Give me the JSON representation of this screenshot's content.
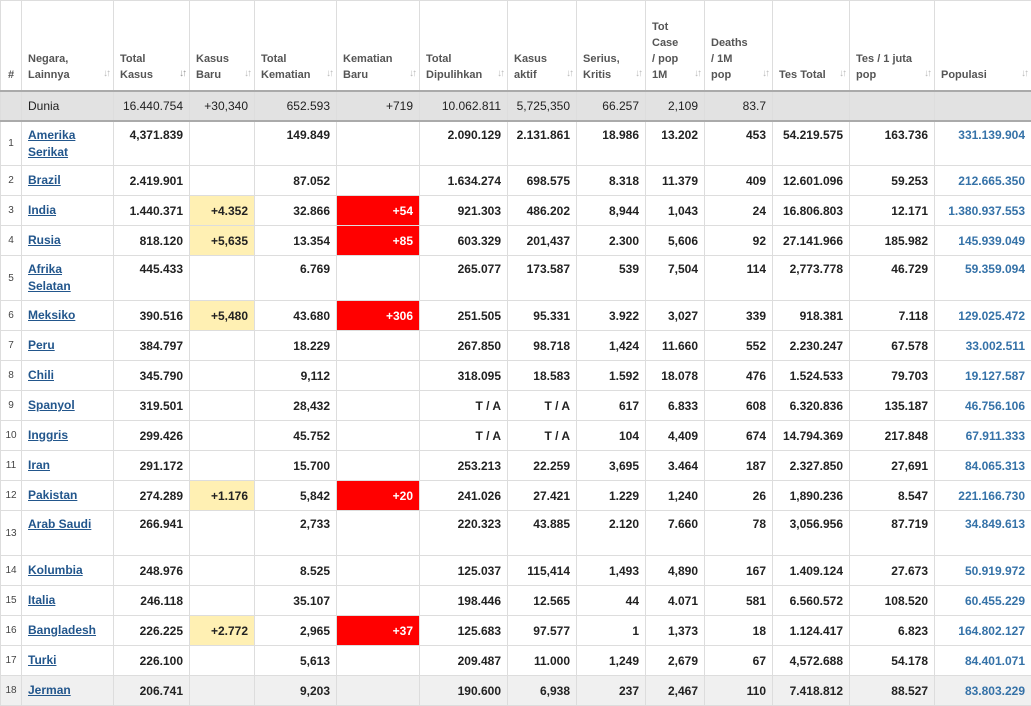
{
  "headers": [
    {
      "label": "#",
      "sort": false
    },
    {
      "label": "Negara, Lainnya",
      "sort": true
    },
    {
      "label": "Total Kasus",
      "sort": true,
      "active": true
    },
    {
      "label": "Kasus Baru",
      "sort": true
    },
    {
      "label": "Total Kematian",
      "sort": true
    },
    {
      "label": "Kematian Baru",
      "sort": true
    },
    {
      "label": "Total Dipulihkan",
      "sort": true
    },
    {
      "label": "Kasus aktif",
      "sort": true
    },
    {
      "label": "Serius, Kritis",
      "sort": true
    },
    {
      "label": "Tot Case / pop 1M",
      "sort": true
    },
    {
      "label": "Deaths / 1M pop",
      "sort": true
    },
    {
      "label": "Tes Total",
      "sort": true
    },
    {
      "label": "Tes / 1 juta pop",
      "sort": true
    },
    {
      "label": "Populasi",
      "sort": true
    }
  ],
  "sort_icon": "sort-arrows-icon",
  "world": {
    "num": "",
    "country": "Dunia",
    "total_cases": "16.440.754",
    "new_cases": "+30,340",
    "total_deaths": "652.593",
    "new_deaths": "+719",
    "recovered": "10.062.811",
    "active": "5,725,350",
    "critical": "66.257",
    "cases_per_1m": "2,109",
    "deaths_per_1m": "83.7",
    "tests": "",
    "tests_per_1m": "",
    "population": ""
  },
  "rows": [
    {
      "num": "1",
      "country": "Amerika Serikat",
      "total_cases": "4,371.839",
      "new_cases": "",
      "total_deaths": "149.849",
      "new_deaths": "",
      "recovered": "2.090.129",
      "active": "2.131.861",
      "critical": "18.986",
      "cases_per_1m": "13.202",
      "deaths_per_1m": "453",
      "tests": "54.219.575",
      "tests_per_1m": "163.736",
      "population": "331.139.904"
    },
    {
      "num": "2",
      "country": "Brazil",
      "total_cases": "2.419.901",
      "new_cases": "",
      "total_deaths": "87.052",
      "new_deaths": "",
      "recovered": "1.634.274",
      "active": "698.575",
      "critical": "8.318",
      "cases_per_1m": "11.379",
      "deaths_per_1m": "409",
      "tests": "12.601.096",
      "tests_per_1m": "59.253",
      "population": "212.665.350"
    },
    {
      "num": "3",
      "country": "India",
      "total_cases": "1.440.371",
      "new_cases": "+4.352",
      "total_deaths": "32.866",
      "new_deaths": "+54",
      "recovered": "921.303",
      "active": "486.202",
      "critical": "8,944",
      "cases_per_1m": "1,043",
      "deaths_per_1m": "24",
      "tests": "16.806.803",
      "tests_per_1m": "12.171",
      "population": "1.380.937.553"
    },
    {
      "num": "4",
      "country": "Rusia",
      "total_cases": "818.120",
      "new_cases": "+5,635",
      "total_deaths": "13.354",
      "new_deaths": "+85",
      "recovered": "603.329",
      "active": "201,437",
      "critical": "2.300",
      "cases_per_1m": "5,606",
      "deaths_per_1m": "92",
      "tests": "27.141.966",
      "tests_per_1m": "185.982",
      "population": "145.939.049"
    },
    {
      "num": "5",
      "country": "Afrika Selatan",
      "total_cases": "445.433",
      "new_cases": "",
      "total_deaths": "6.769",
      "new_deaths": "",
      "recovered": "265.077",
      "active": "173.587",
      "critical": "539",
      "cases_per_1m": "7,504",
      "deaths_per_1m": "114",
      "tests": "2,773.778",
      "tests_per_1m": "46.729",
      "population": "59.359.094"
    },
    {
      "num": "6",
      "country": "Meksiko",
      "total_cases": "390.516",
      "new_cases": "+5,480",
      "total_deaths": "43.680",
      "new_deaths": "+306",
      "recovered": "251.505",
      "active": "95.331",
      "critical": "3.922",
      "cases_per_1m": "3,027",
      "deaths_per_1m": "339",
      "tests": "918.381",
      "tests_per_1m": "7.118",
      "population": "129.025.472"
    },
    {
      "num": "7",
      "country": "Peru",
      "total_cases": "384.797",
      "new_cases": "",
      "total_deaths": "18.229",
      "new_deaths": "",
      "recovered": "267.850",
      "active": "98.718",
      "critical": "1,424",
      "cases_per_1m": "11.660",
      "deaths_per_1m": "552",
      "tests": "2.230.247",
      "tests_per_1m": "67.578",
      "population": "33.002.511"
    },
    {
      "num": "8",
      "country": "Chili",
      "total_cases": "345.790",
      "new_cases": "",
      "total_deaths": "9,112",
      "new_deaths": "",
      "recovered": "318.095",
      "active": "18.583",
      "critical": "1.592",
      "cases_per_1m": "18.078",
      "deaths_per_1m": "476",
      "tests": "1.524.533",
      "tests_per_1m": "79.703",
      "population": "19.127.587"
    },
    {
      "num": "9",
      "country": "Spanyol",
      "total_cases": "319.501",
      "new_cases": "",
      "total_deaths": "28,432",
      "new_deaths": "",
      "recovered": "T / A",
      "active": "T / A",
      "critical": "617",
      "cases_per_1m": "6.833",
      "deaths_per_1m": "608",
      "tests": "6.320.836",
      "tests_per_1m": "135.187",
      "population": "46.756.106"
    },
    {
      "num": "10",
      "country": "Inggris",
      "total_cases": "299.426",
      "new_cases": "",
      "total_deaths": "45.752",
      "new_deaths": "",
      "recovered": "T / A",
      "active": "T / A",
      "critical": "104",
      "cases_per_1m": "4,409",
      "deaths_per_1m": "674",
      "tests": "14.794.369",
      "tests_per_1m": "217.848",
      "population": "67.911.333"
    },
    {
      "num": "11",
      "country": "Iran",
      "total_cases": "291.172",
      "new_cases": "",
      "total_deaths": "15.700",
      "new_deaths": "",
      "recovered": "253.213",
      "active": "22.259",
      "critical": "3,695",
      "cases_per_1m": "3.464",
      "deaths_per_1m": "187",
      "tests": "2.327.850",
      "tests_per_1m": "27,691",
      "population": "84.065.313"
    },
    {
      "num": "12",
      "country": "Pakistan",
      "total_cases": "274.289",
      "new_cases": "+1.176",
      "total_deaths": "5,842",
      "new_deaths": "+20",
      "recovered": "241.026",
      "active": "27.421",
      "critical": "1.229",
      "cases_per_1m": "1,240",
      "deaths_per_1m": "26",
      "tests": "1,890.236",
      "tests_per_1m": "8.547",
      "population": "221.166.730"
    },
    {
      "num": "13",
      "country": "Arab Saudi",
      "total_cases": "266.941",
      "new_cases": "",
      "total_deaths": "2,733",
      "new_deaths": "",
      "recovered": "220.323",
      "active": "43.885",
      "critical": "2.120",
      "cases_per_1m": "7.660",
      "deaths_per_1m": "78",
      "tests": "3,056.956",
      "tests_per_1m": "87.719",
      "population": "34.849.613"
    },
    {
      "num": "14",
      "country": "Kolumbia",
      "total_cases": "248.976",
      "new_cases": "",
      "total_deaths": "8.525",
      "new_deaths": "",
      "recovered": "125.037",
      "active": "115,414",
      "critical": "1,493",
      "cases_per_1m": "4,890",
      "deaths_per_1m": "167",
      "tests": "1.409.124",
      "tests_per_1m": "27.673",
      "population": "50.919.972"
    },
    {
      "num": "15",
      "country": "Italia",
      "total_cases": "246.118",
      "new_cases": "",
      "total_deaths": "35.107",
      "new_deaths": "",
      "recovered": "198.446",
      "active": "12.565",
      "critical": "44",
      "cases_per_1m": "4.071",
      "deaths_per_1m": "581",
      "tests": "6.560.572",
      "tests_per_1m": "108.520",
      "population": "60.455.229"
    },
    {
      "num": "16",
      "country": "Bangladesh",
      "total_cases": "226.225",
      "new_cases": "+2.772",
      "total_deaths": "2,965",
      "new_deaths": "+37",
      "recovered": "125.683",
      "active": "97.577",
      "critical": "1",
      "cases_per_1m": "1,373",
      "deaths_per_1m": "18",
      "tests": "1.124.417",
      "tests_per_1m": "6.823",
      "population": "164.802.127"
    },
    {
      "num": "17",
      "country": "Turki",
      "total_cases": "226.100",
      "new_cases": "",
      "total_deaths": "5,613",
      "new_deaths": "",
      "recovered": "209.487",
      "active": "11.000",
      "critical": "1,249",
      "cases_per_1m": "2,679",
      "deaths_per_1m": "67",
      "tests": "4,572.688",
      "tests_per_1m": "54.178",
      "population": "84.401.071"
    },
    {
      "num": "18",
      "country": "Jerman",
      "total_cases": "206.741",
      "new_cases": "",
      "total_deaths": "9,203",
      "new_deaths": "",
      "recovered": "190.600",
      "active": "6,938",
      "critical": "237",
      "cases_per_1m": "2,467",
      "deaths_per_1m": "110",
      "tests": "7.418.812",
      "tests_per_1m": "88.527",
      "population": "83.803.229"
    }
  ],
  "colors": {
    "new_cases_highlight": "#fff0b3",
    "new_deaths_highlight": "#ff0000",
    "country_link": "#22568c",
    "population_text": "#3572a8",
    "world_row": "#e2e2e2"
  }
}
